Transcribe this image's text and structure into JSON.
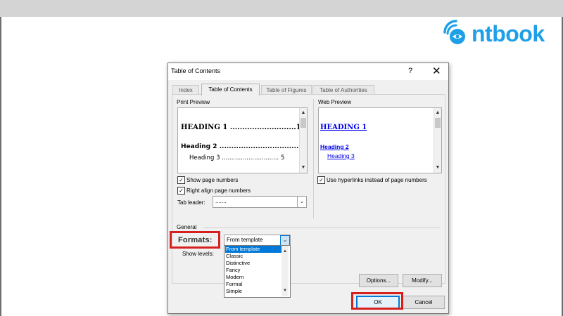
{
  "brand": {
    "logo_text": "ntbook",
    "color": "#1ea0e8",
    "mark_icon": "cloud-book-icon"
  },
  "dialog": {
    "title": "Table of Contents",
    "help_label": "?",
    "close_label": "✕",
    "tabs": [
      {
        "label": "Index",
        "active": false
      },
      {
        "label": "Table of Contents",
        "active": true
      },
      {
        "label": "Table of Figures",
        "active": false
      },
      {
        "label": "Table of Authorities",
        "active": false
      }
    ],
    "print_preview": {
      "label": "Print Preview",
      "heading1": "HEADING 1 ...........................1",
      "heading2": "Heading 2 ................................. 3",
      "heading3": "Heading 3 .............................. 5"
    },
    "web_preview": {
      "label": "Web Preview",
      "heading1": "HEADING 1",
      "heading2": "Heading 2",
      "heading3": "Heading 3"
    },
    "options": {
      "show_page_numbers": {
        "label": "Show page numbers",
        "checked": true
      },
      "right_align": {
        "label": "Right align page numbers",
        "checked": true
      },
      "use_hyperlinks": {
        "label": "Use hyperlinks instead of page numbers",
        "checked": true
      },
      "tab_leader_label": "Tab leader:",
      "tab_leader_value": "......."
    },
    "general": {
      "section_label": "General",
      "formats_label": "Formats:",
      "formats_value": "From template",
      "show_levels_label": "Show levels:",
      "format_options": [
        "From template",
        "Classic",
        "Distinctive",
        "Fancy",
        "Modern",
        "Formal",
        "Simple"
      ],
      "selected_index": 0
    },
    "buttons": {
      "options": "Options...",
      "modify": "Modify...",
      "ok": "OK",
      "cancel": "Cancel"
    },
    "scroll_up": "▲",
    "scroll_down": "▼",
    "check_glyph": "✓",
    "combo_arrow": "⌄"
  },
  "colors": {
    "highlight": "#d6201f",
    "link": "#0000ee",
    "selection": "#0078d7"
  }
}
